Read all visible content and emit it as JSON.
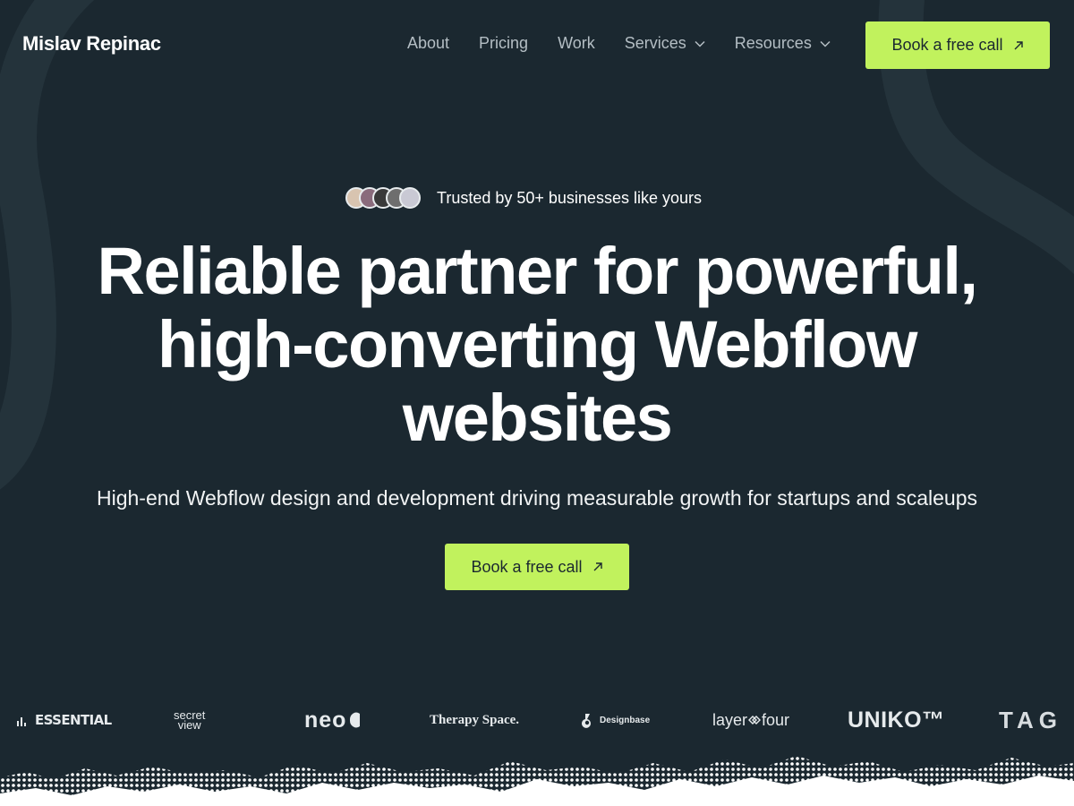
{
  "brand": {
    "name": "Mislav Repinac"
  },
  "nav": {
    "items": [
      {
        "label": "About"
      },
      {
        "label": "Pricing"
      },
      {
        "label": "Work"
      },
      {
        "label": "Services"
      },
      {
        "label": "Resources"
      }
    ],
    "cta_label": "Book a free call"
  },
  "hero": {
    "trusted_text": "Trusted by 50+ businesses like yours",
    "headline_lines": [
      "Reliable partner for powerful,",
      "high-converting Webflow",
      "websites"
    ],
    "subtitle": "High-end Webflow design and development driving measurable growth for startups and scaleups",
    "cta_label": "Book a free call"
  },
  "logos": {
    "essential": "ESSENTIAL",
    "secret_view": [
      "secret",
      "view"
    ],
    "neo": "neo",
    "therapy_space": "Therapy Space.",
    "designbase": "Designbase",
    "layer_four": [
      "layer",
      "four"
    ],
    "uniko": "UNIKO™",
    "tag": "TAG"
  },
  "colors": {
    "background": "#1b2830",
    "accent": "#c1f25d",
    "nav_text": "#b4bec4",
    "text": "#ffffff"
  },
  "icons": [
    "chevron-down-icon",
    "arrow-up-right-icon"
  ]
}
